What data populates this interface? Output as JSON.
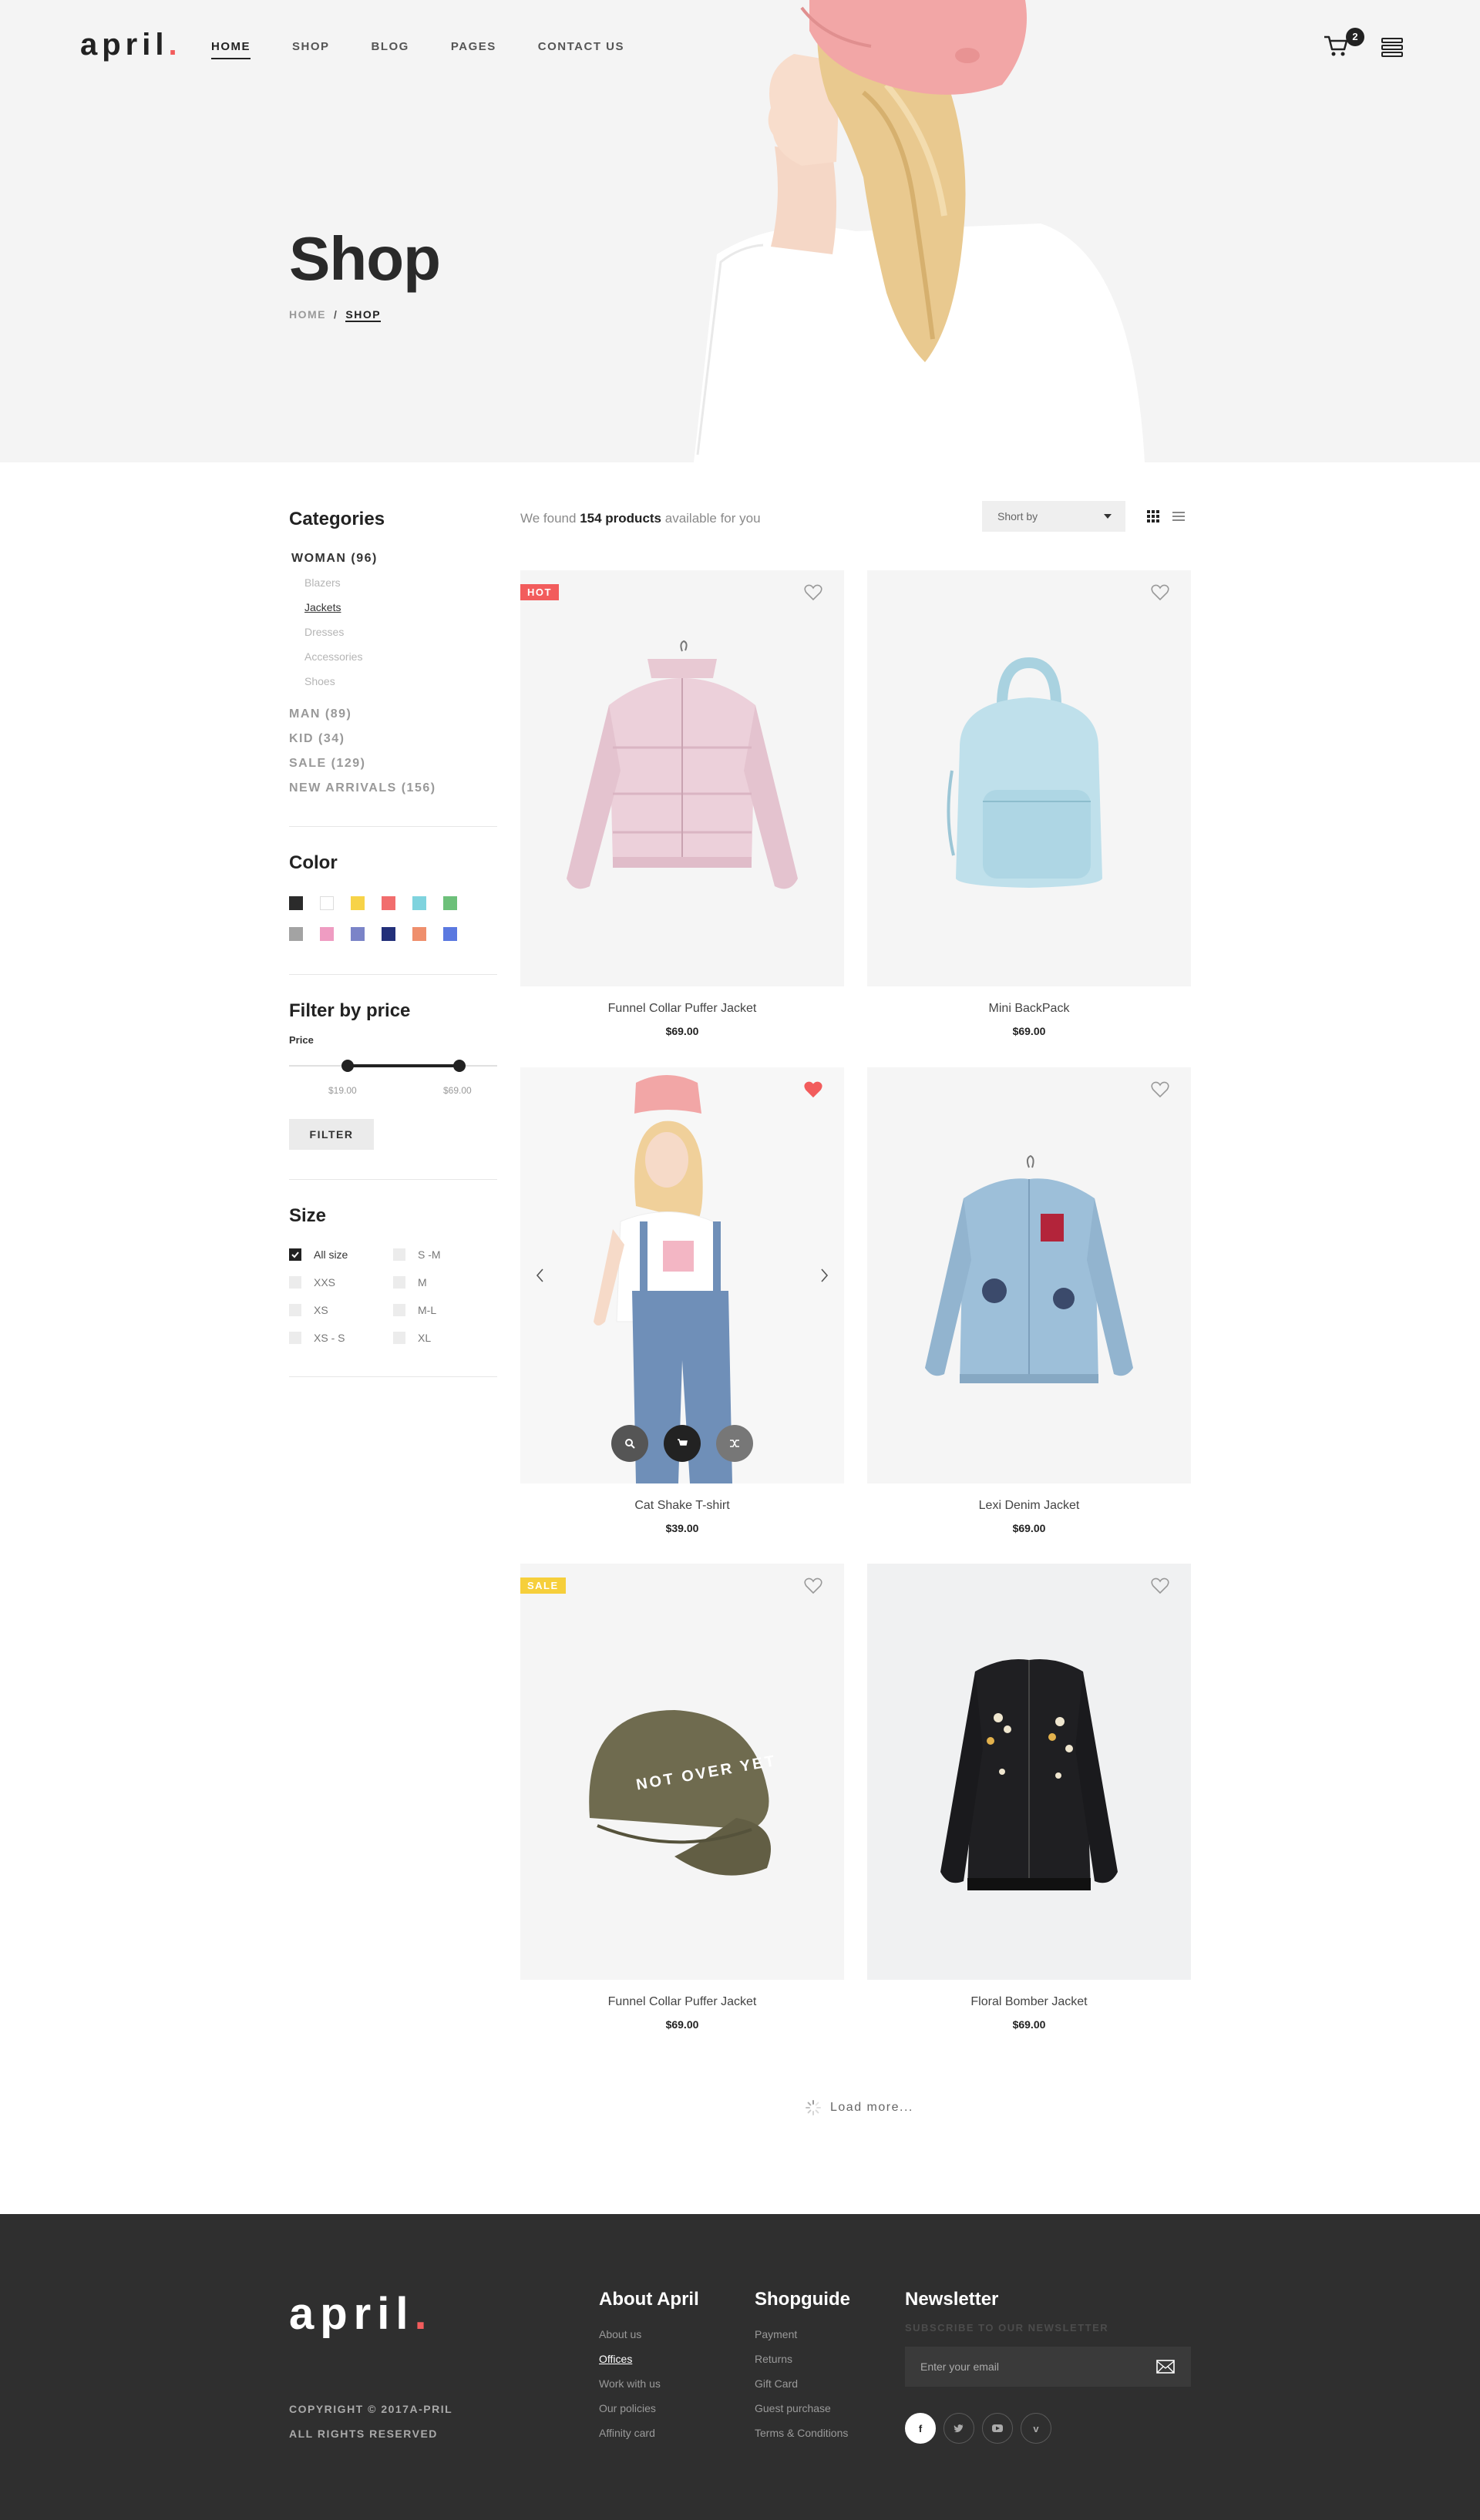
{
  "brand": {
    "name": "april",
    "dot": "."
  },
  "nav": {
    "items": [
      "HOME",
      "SHOP",
      "BLOG",
      "PAGES",
      "CONTACT US"
    ],
    "active": "HOME"
  },
  "cart": {
    "count": "2"
  },
  "hero": {
    "title": "Shop",
    "breadcrumb": {
      "home": "HOME",
      "sep": "/",
      "current": "SHOP"
    }
  },
  "sidebar": {
    "categories_title": "Categories",
    "categories": [
      {
        "label": "WOMAN (96)",
        "active": true
      },
      {
        "label": "MAN (89)"
      },
      {
        "label": "KID (34)"
      },
      {
        "label": "SALE (129)"
      },
      {
        "label": "NEW ARRIVALS (156)"
      }
    ],
    "subcategories": [
      "Blazers",
      "Jackets",
      "Dresses",
      "Accessories",
      "Shoes"
    ],
    "active_subcategory": "Jackets",
    "color_title": "Color",
    "colors": [
      "#2b2b2b",
      "#ffffff",
      "#f7d348",
      "#f16d6d",
      "#7fd3de",
      "#6dc07a",
      "#a3a3a3",
      "#ef9cc2",
      "#7b84c8",
      "#23307a",
      "#ef8f6d",
      "#5b79e0"
    ],
    "price_title": "Filter by price",
    "price_label": "Price",
    "price_min": "$19.00",
    "price_max": "$69.00",
    "price_range_fraction": [
      0.28,
      0.82
    ],
    "filter_button": "FILTER",
    "size_title": "Size",
    "sizes": [
      {
        "label": "All size",
        "checked": true
      },
      {
        "label": "XXS"
      },
      {
        "label": "XS"
      },
      {
        "label": "XS - S"
      },
      {
        "label": "S -M"
      },
      {
        "label": "M"
      },
      {
        "label": "M-L"
      },
      {
        "label": "XL"
      }
    ]
  },
  "toolbar": {
    "found_pre": "We found",
    "found_count": "154 products",
    "found_post": "available for you",
    "sort_label": "Short by"
  },
  "products": [
    {
      "name": "Funnel Collar Puffer Jacket",
      "price": "$69.00",
      "badge": "HOT",
      "liked": false,
      "image": "pink-puffer-jacket"
    },
    {
      "name": "Mini BackPack",
      "price": "$69.00",
      "badge": "",
      "liked": false,
      "image": "blue-backpack"
    },
    {
      "name": "Cat Shake T-shirt",
      "price": "$39.00",
      "badge": "",
      "liked": true,
      "image": "model-overalls"
    },
    {
      "name": "Lexi Denim Jacket",
      "price": "$69.00",
      "badge": "",
      "liked": false,
      "image": "denim-jacket"
    },
    {
      "name": "Funnel Collar Puffer Jacket",
      "price": "$69.00",
      "badge": "SALE",
      "liked": false,
      "image": "olive-cap",
      "cap_text": "NOT OVER YET"
    },
    {
      "name": "Floral Bomber Jacket",
      "price": "$69.00",
      "badge": "",
      "liked": false,
      "image": "black-bomber"
    }
  ],
  "load_more": "Load more...",
  "footer": {
    "copyright_1": "COPYRIGHT © 2017A-PRIL",
    "copyright_2": "ALL RIGHTS RESERVED",
    "about_title": "About April",
    "about_links": [
      "About us",
      "Offices",
      "Work with us",
      "Our policies",
      "Affinity card"
    ],
    "shop_title": "Shopguide",
    "shop_links": [
      "Payment",
      "Returns",
      "Gift Card",
      "Guest purchase",
      "Terms & Conditions"
    ],
    "newsletter_title": "Newsletter",
    "newsletter_sub": "SUBSCRIBE TO OUR NEWSLETTER",
    "email_placeholder": "Enter your email",
    "social": [
      "facebook-icon",
      "twitter-icon",
      "youtube-icon",
      "vimeo-icon"
    ]
  },
  "accent": "#f25c5c"
}
